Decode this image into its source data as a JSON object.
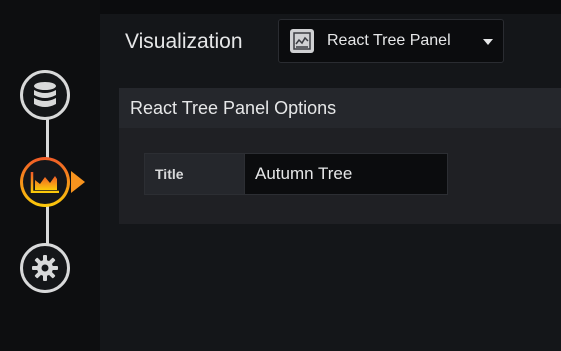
{
  "steps": [
    {
      "name": "Queries",
      "icon": "database-icon",
      "active": false
    },
    {
      "name": "Visualization",
      "icon": "area-chart-icon",
      "active": true
    },
    {
      "name": "General",
      "icon": "gear-icon",
      "active": false
    }
  ],
  "visualization": {
    "label": "Visualization",
    "selected": "React Tree Panel",
    "thumb_icon": "panel-thumbnail-icon"
  },
  "options": {
    "header": "React Tree Panel Options",
    "title_label": "Title",
    "title_value": "Autumn Tree"
  },
  "colors": {
    "active_gradient_start": "#f05a28",
    "active_gradient_end": "#fbca0a",
    "rail_line": "#d8d9da",
    "panel_bg": "#141619"
  }
}
